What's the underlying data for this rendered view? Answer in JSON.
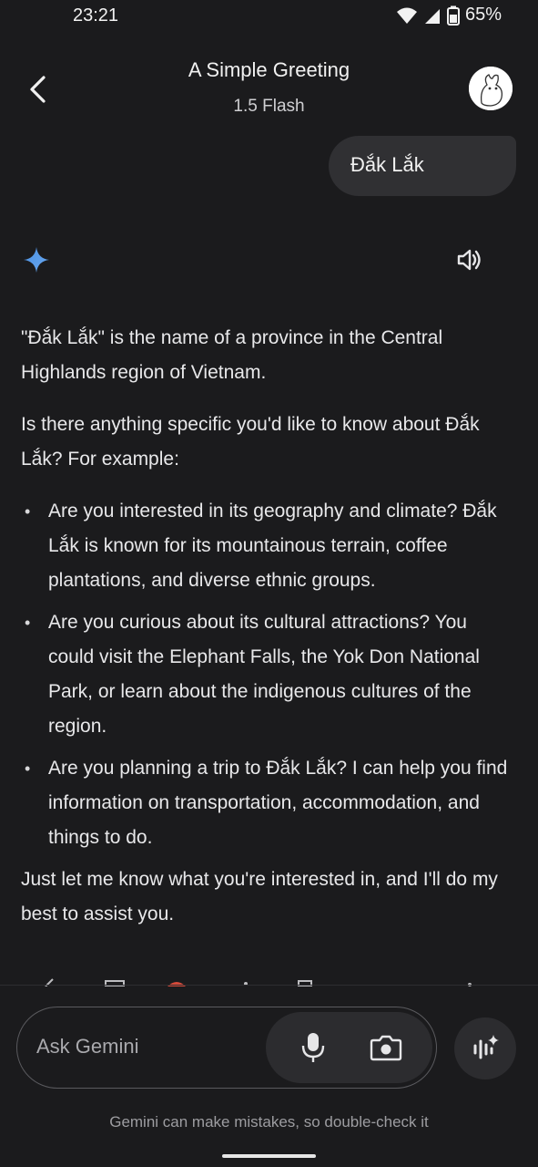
{
  "status": {
    "time": "23:21",
    "battery": "65%"
  },
  "header": {
    "title": "A Simple Greeting",
    "model": "1.5 Flash"
  },
  "user_message": "Đắk Lắk",
  "answer": {
    "p1": "\"Đắk Lắk\" is the name of a province in the Central Highlands region of Vietnam.",
    "p2": "Is there anything specific you'd like to know about Đắk Lắk? For example:",
    "bullets": [
      "Are you interested in its geography and climate? Đắk Lắk is known for its mountainous terrain, coffee plantations, and diverse ethnic groups.",
      "Are you curious about its cultural attractions? You could visit the Elephant Falls, the Yok Don National Park, or learn about the indigenous cultures of the region.",
      "Are you planning a trip to Đắk Lắk? I can help you find information on transportation, accommodation, and things to do."
    ],
    "closing": "Just let me know what you're interested in, and I'll do my best to assist you."
  },
  "input": {
    "placeholder": "Ask Gemini"
  },
  "disclaimer": "Gemini can make mistakes, so double-check it",
  "icons": {
    "back": "back-arrow-icon",
    "avatar": "avatar",
    "sparkle": "gemini-sparkle-icon",
    "speaker": "speaker-icon",
    "mic": "mic-icon",
    "camera": "camera-icon",
    "live": "live-icon"
  },
  "colors": {
    "background": "#1b1b1d",
    "bubble": "#303033",
    "sparkle": "#4a90e2"
  }
}
